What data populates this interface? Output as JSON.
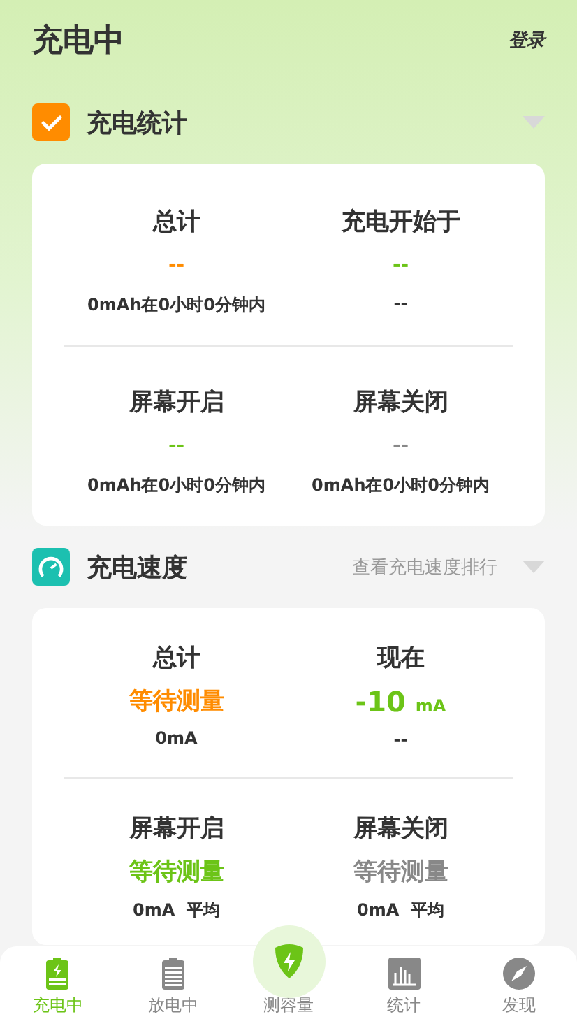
{
  "header": {
    "title": "充电中",
    "login": "登录"
  },
  "sections": [
    {
      "kind": "stats",
      "title": "充电统计",
      "expanded": false,
      "cells": [
        {
          "title": "总计",
          "value": "--",
          "color": "#ff8c00",
          "sub": "0mAh在0小时0分钟内"
        },
        {
          "title": "充电开始于",
          "value": "--",
          "color": "#6cc417",
          "sub": "--"
        },
        {
          "title": "屏幕开启",
          "value": "--",
          "color": "#6cc417",
          "sub": "0mAh在0小时0分钟内"
        },
        {
          "title": "屏幕关闭",
          "value": "--",
          "color": "#888888",
          "sub": "0mAh在0小时0分钟内"
        }
      ]
    },
    {
      "kind": "speed",
      "title": "充电速度",
      "link": "查看充电速度排行",
      "expanded": false,
      "cells": [
        {
          "title": "总计",
          "value": "等待测量",
          "color": "#ff8c00",
          "sub": "0mA"
        },
        {
          "title": "现在",
          "value": "-10",
          "unit": "mA",
          "color": "#6cc417",
          "sub": "--"
        },
        {
          "title": "屏幕开启",
          "value": "等待测量",
          "color": "#6cc417",
          "sub": "0mA",
          "sub_extra": "平均"
        },
        {
          "title": "屏幕关闭",
          "value": "等待测量",
          "color": "#888888",
          "sub": "0mA",
          "sub_extra": "平均"
        }
      ]
    }
  ],
  "nav": [
    {
      "kind": "charging",
      "label": "充电中",
      "selected": true
    },
    {
      "kind": "battery",
      "label": "放电中",
      "selected": false
    },
    {
      "kind": "measure",
      "label": "测容量",
      "selected": false
    },
    {
      "kind": "stats",
      "label": "统计",
      "selected": false
    },
    {
      "kind": "compass",
      "label": "发现",
      "selected": false
    }
  ]
}
